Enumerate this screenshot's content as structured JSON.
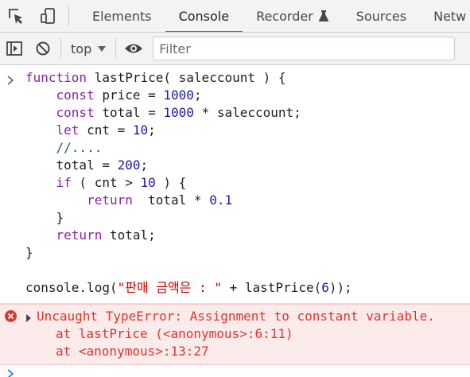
{
  "tabs": [
    {
      "label": "Elements"
    },
    {
      "label": "Console"
    },
    {
      "label": "Recorder"
    },
    {
      "label": "Sources"
    },
    {
      "label": "Netw"
    }
  ],
  "toolbar": {
    "context": "top",
    "filter_placeholder": "Filter"
  },
  "code": {
    "l1_kw": "function",
    "l1_rest": " lastPrice( saleccount ) {",
    "l2_kw": "const",
    "l2_a": " price = ",
    "l2_num": "1000",
    "l2_end": ";",
    "l3_kw": "const",
    "l3_a": " total = ",
    "l3_num": "1000",
    "l3_b": " * saleccount;",
    "l4_kw": "let",
    "l4_a": " cnt = ",
    "l4_num": "10",
    "l4_end": ";",
    "l5_comment": "//....",
    "l6_a": "total = ",
    "l6_num": "200",
    "l6_end": ";",
    "l7_kw": "if",
    "l7_a": " ( cnt > ",
    "l7_num": "10",
    "l7_b": " ) {",
    "l8_kw": "return",
    "l8_a": "  total * ",
    "l8_num": "0.1",
    "l9": "}",
    "l10_kw": "return",
    "l10_a": " total;",
    "l11": "}",
    "l13_a": "console.log(",
    "l13_str": "\"판매 금액은 : \"",
    "l13_b": " + lastPrice(",
    "l13_num": "6",
    "l13_c": "));"
  },
  "error": {
    "message": "Uncaught TypeError: Assignment to constant variable.",
    "stack_1": "at lastPrice (<anonymous>:6:11)",
    "stack_2": "at <anonymous>:13:27"
  },
  "colors": {
    "active_tab_underline": "#1a73e8",
    "keyword": "#8b24a8",
    "number": "#1a1aa6",
    "string": "#c80000",
    "comment": "#236e25",
    "error_text": "#dc362e",
    "error_bg": "#fcebeb"
  },
  "icons": [
    "inspect-element-icon",
    "device-toolbar-icon",
    "flask-icon",
    "sidebar-toggle-icon",
    "clear-console-icon",
    "dropdown-caret-icon",
    "eye-icon",
    "prompt-chevron-icon",
    "error-icon",
    "expand-caret-icon"
  ]
}
